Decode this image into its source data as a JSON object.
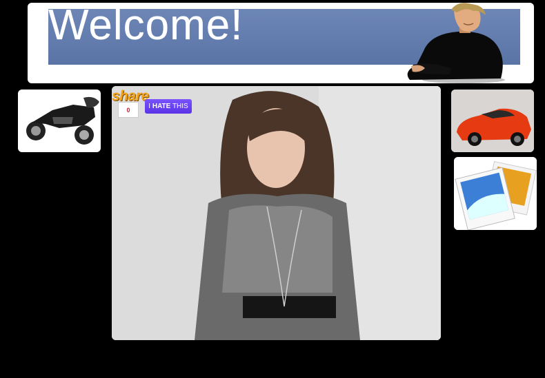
{
  "banner": {
    "title": "Welcome!"
  },
  "share_widget": {
    "logo_text": "share",
    "count": "0",
    "button_prefix": "I",
    "button_emphasis": "HATE",
    "button_suffix": "THIS"
  },
  "sidebar_left": {
    "items": [
      "motorcycle-image"
    ]
  },
  "sidebar_right": {
    "items": [
      "red-sports-car-image",
      "photo-gallery-icon"
    ]
  },
  "colors": {
    "page_bg": "#000000",
    "banner_band": "#6d86b6",
    "share_orange": "#f3a51e",
    "hate_purple": "#6a43f0"
  }
}
